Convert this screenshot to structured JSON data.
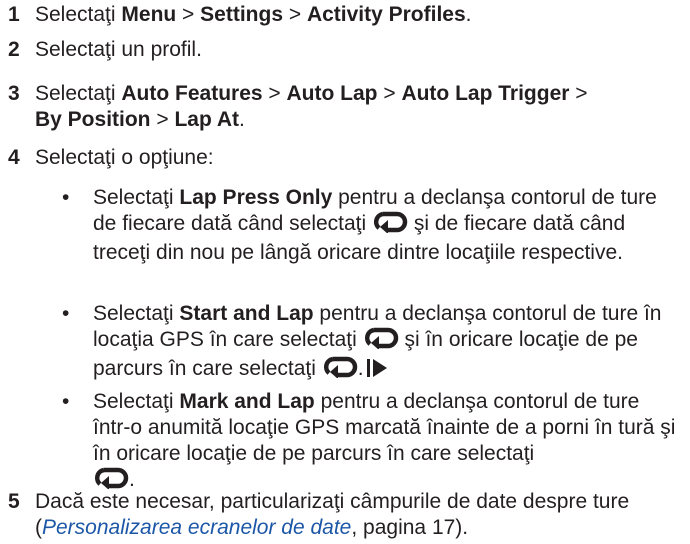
{
  "steps": [
    {
      "number": "1",
      "t1": "Selectaţi ",
      "b1": "Menu",
      "t2": " > ",
      "b2": "Settings",
      "t3": " > ",
      "b3": "Activity Profiles",
      "t4": "."
    },
    {
      "number": "2",
      "text": "Selectaţi un profil."
    },
    {
      "number": "3",
      "t1": "Selectaţi ",
      "b1": "Auto Features",
      "t2": " > ",
      "b2": "Auto Lap",
      "t3": " > ",
      "b3": "Auto Lap Trigger",
      "t4": " > ",
      "b4": "By Position",
      "t5": " > ",
      "b5": "Lap At",
      "t6": "."
    },
    {
      "number": "4",
      "text": "Selectaţi o opţiune:"
    },
    {
      "number": "5",
      "t1": "Dacă este necesar, particularizaţi câmpurile de date despre ture (",
      "link": "Personalizarea ecranelor de date",
      "t2": ", pagina 17)."
    }
  ],
  "options": [
    {
      "t1": "Selectaţi ",
      "b1": "Lap Press Only",
      "t2": " pentru a declanşa contorul de ture de fiecare dată când selectaţi ",
      "t3": " şi de fiecare dată când treceţi din nou pe lângă oricare dintre locaţiile respective."
    },
    {
      "t1": "Selectaţi ",
      "b1": "Start and Lap",
      "t2": " pentru a declanşa contorul de ture în locaţia GPS în care selectaţi ",
      "t3": " şi în oricare locaţie de pe parcurs în care selectaţi ",
      "t4": "."
    },
    {
      "t1": "Selectaţi ",
      "b1": "Mark and Lap",
      "t2": " pentru a declanşa contorul de ture într-o anumită locaţie GPS marcată înainte de a porni în tură şi în oricare locaţie de pe parcurs în care selectaţi ",
      "t3": "."
    }
  ],
  "bullet_char": "•",
  "icons": {
    "lap": "lap-loop-icon",
    "continued": "continued-triangle-icon"
  },
  "colors": {
    "text": "#231f20",
    "link": "#1c57a7"
  }
}
